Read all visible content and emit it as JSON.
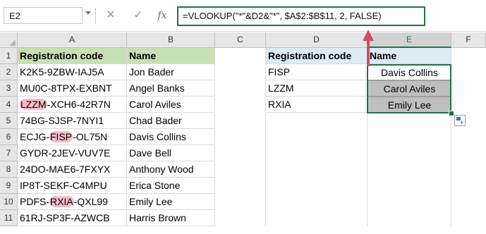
{
  "formula_bar": {
    "name_box": "E2",
    "cancel_glyph": "✕",
    "enter_glyph": "✓",
    "fx_label": "fx",
    "formula": "=VLOOKUP(\"*\"&D2&\"*\", $A$2:$B$11, 2, FALSE)"
  },
  "columns": [
    "A",
    "B",
    "C",
    "D",
    "E",
    "F"
  ],
  "rows": [
    "1",
    "2",
    "3",
    "4",
    "5",
    "6",
    "7",
    "8",
    "9",
    "10",
    "11"
  ],
  "table_left": {
    "header": {
      "code": "Registration code",
      "name": "Name"
    },
    "rows": [
      {
        "pre": "K2K5-9ZBW-IAJ5A",
        "hl": "",
        "post": "",
        "name": "Jon Bader"
      },
      {
        "pre": "MU0C-8TPX-EXBNT",
        "hl": "",
        "post": "",
        "name": "Angel Banks"
      },
      {
        "pre": "",
        "hl": "LZZM",
        "post": "-XCH6-42R7N",
        "name": "Carol Aviles"
      },
      {
        "pre": "74BG-SJSP-7NYI1",
        "hl": "",
        "post": "",
        "name": "Chad Bader"
      },
      {
        "pre": "ECJG-",
        "hl": "FISP",
        "post": "-OL75N",
        "name": "Davis Collins"
      },
      {
        "pre": "GYDR-2JEV-VUV7E",
        "hl": "",
        "post": "",
        "name": "Dave Bell"
      },
      {
        "pre": "24DO-MAE6-7FXYX",
        "hl": "",
        "post": "",
        "name": "Anthony Wood"
      },
      {
        "pre": "IP8T-SEKF-C4MPU",
        "hl": "",
        "post": "",
        "name": "Erica Stone"
      },
      {
        "pre": "PDFS-",
        "hl": "RXIA",
        "post": "-QXL99",
        "name": "Emily Lee"
      },
      {
        "pre": "61RJ-SP3F-AZWCB",
        "hl": "",
        "post": "",
        "name": "Harris Brown"
      }
    ]
  },
  "table_right": {
    "header": {
      "code": "Registration code",
      "name": "Name"
    },
    "rows": [
      {
        "code": "FISP",
        "name": "Davis Collins"
      },
      {
        "code": "LZZM",
        "name": "Carol Aviles"
      },
      {
        "code": "RXIA",
        "name": "Emily Lee"
      }
    ]
  },
  "colors": {
    "accent": "#217346",
    "green_header": "#c6e0b4",
    "blue_header": "#ddebf7",
    "highlight": "#f8bcc8",
    "arrow": "#d14b66"
  },
  "icons": {
    "quick_analysis": "paste-options-icon",
    "arrow": "up-arrow-icon"
  }
}
